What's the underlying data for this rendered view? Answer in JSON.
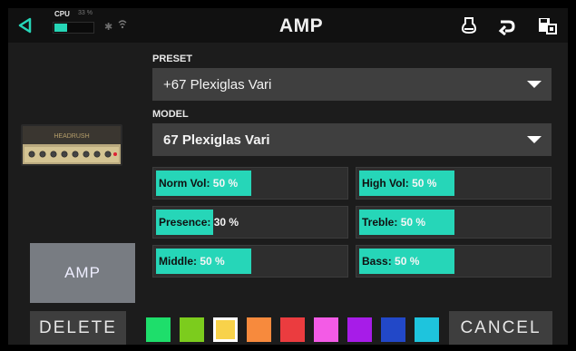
{
  "header": {
    "title": "AMP",
    "cpu_label": "CPU",
    "cpu_percent_text": "33 %",
    "cpu_usage_fraction": 0.33,
    "icons": [
      "back-icon",
      "bluetooth-icon",
      "wifi-icon",
      "tuner-icon",
      "undo-icon",
      "save-icon"
    ]
  },
  "preset": {
    "label": "PRESET",
    "value": "+67 Plexiglas Vari"
  },
  "model": {
    "label": "MODEL",
    "value": "67 Plexiglas Vari",
    "thumbnail_brand": "HEADRUSH"
  },
  "params": [
    {
      "name": "Norm Vol",
      "value": "50 %",
      "fraction": 0.5
    },
    {
      "name": "High Vol",
      "value": "50 %",
      "fraction": 0.5
    },
    {
      "name": "Presence",
      "value": "30 %",
      "fraction": 0.3
    },
    {
      "name": "Treble",
      "value": "50 %",
      "fraction": 0.5
    },
    {
      "name": "Middle",
      "value": "50 %",
      "fraction": 0.5
    },
    {
      "name": "Bass",
      "value": "50 %",
      "fraction": 0.5
    }
  ],
  "block_button": {
    "label": "AMP"
  },
  "delete_button": {
    "label": "DELETE"
  },
  "cancel_button": {
    "label": "CANCEL"
  },
  "colors": {
    "accent": "#26d6b8",
    "swatches": [
      "#1ede6b",
      "#7ccc1d",
      "#f8d24a",
      "#f78a3d",
      "#eb3c3f",
      "#f35be6",
      "#a71ce8",
      "#2248c8",
      "#1ec4dd"
    ],
    "selected_swatch": 2
  }
}
